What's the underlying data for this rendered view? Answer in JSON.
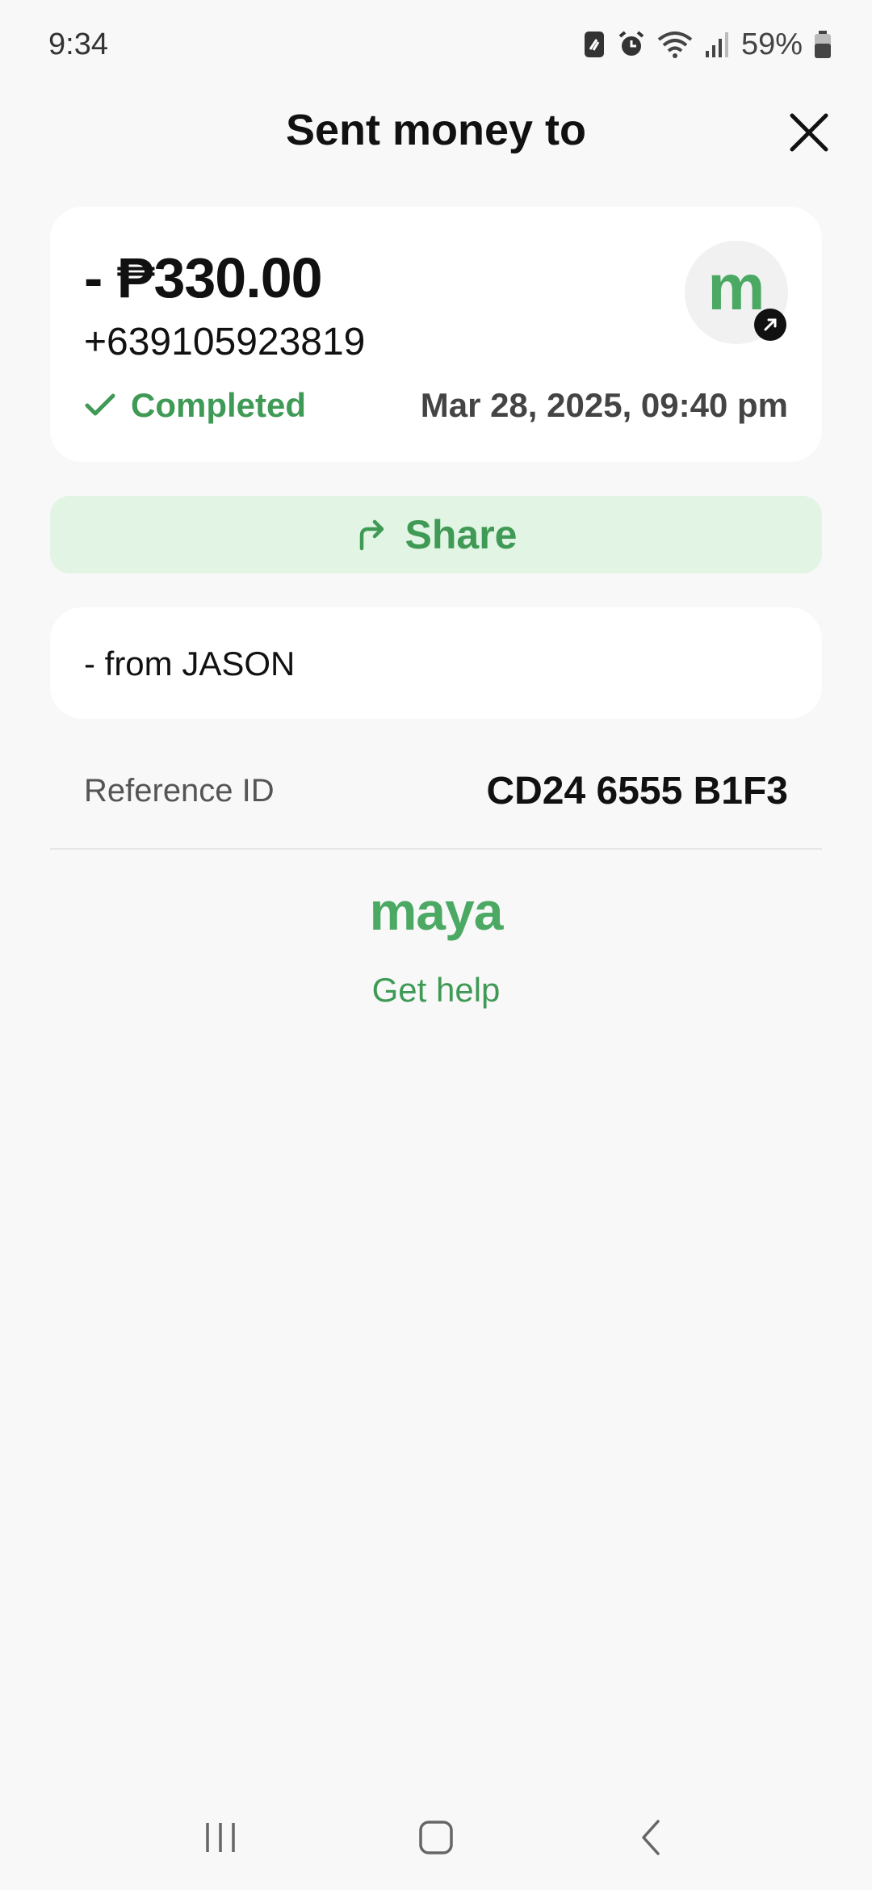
{
  "status_bar": {
    "time": "9:34",
    "battery": "59%",
    "icons": [
      "nfc-icon",
      "alarm-icon",
      "wifi-icon",
      "signal-icon",
      "battery-icon"
    ]
  },
  "header": {
    "title": "Sent money to",
    "close_icon": "close-icon"
  },
  "transaction": {
    "amount": "- ₱330.00",
    "recipient": "+639105923819",
    "status": "Completed",
    "date": "Mar 28, 2025, 09:40 pm",
    "avatar_letter": "m"
  },
  "share": {
    "label": "Share"
  },
  "message": {
    "text": "- from JASON"
  },
  "reference": {
    "label": "Reference ID",
    "value": "CD24 6555 B1F3"
  },
  "footer": {
    "brand": "maya",
    "help_label": "Get help"
  },
  "colors": {
    "accent": "#3f9a55",
    "share_bg": "#e2f4e3",
    "background": "#f8f8f8"
  }
}
